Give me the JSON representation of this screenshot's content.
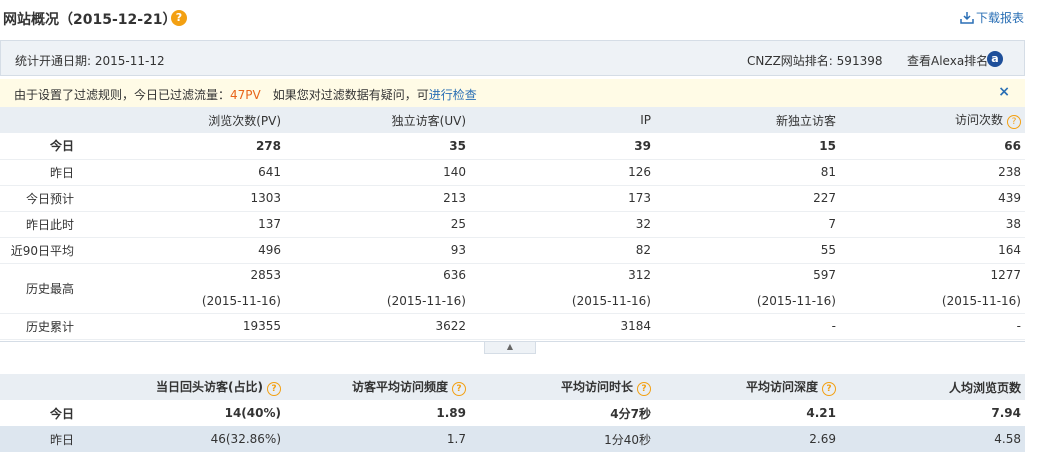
{
  "header": {
    "title": "网站概况（2015-12-21）",
    "help_icon": "?",
    "download_label": "下载报表"
  },
  "info_bar": {
    "open_date_label": "统计开通日期:",
    "open_date": "2015-11-12",
    "rank_label": "CNZZ网站排名:",
    "rank_value": "591398",
    "alexa_label": "查看Alexa排名",
    "alexa_icon": "a"
  },
  "notice": {
    "prefix": "由于设置了过滤规则，今日已过滤流量：",
    "filtered": "47PV",
    "middle": "　如果您对过滤数据有疑问，可",
    "link": "进行检查",
    "close": "×"
  },
  "table1": {
    "headers": [
      "",
      "浏览次数(PV)",
      "独立访客(UV)",
      "IP",
      "新独立访客",
      "访问次数"
    ],
    "rows": [
      {
        "label": "今日",
        "values": [
          "278",
          "35",
          "39",
          "15",
          "66"
        ]
      },
      {
        "label": "昨日",
        "values": [
          "641",
          "140",
          "126",
          "81",
          "238"
        ]
      },
      {
        "label": "今日预计",
        "values": [
          "1303",
          "213",
          "173",
          "227",
          "439"
        ]
      },
      {
        "label": "昨日此时",
        "values": [
          "137",
          "25",
          "32",
          "7",
          "38"
        ]
      },
      {
        "label": "近90日平均",
        "values": [
          "496",
          "93",
          "82",
          "55",
          "164"
        ]
      }
    ],
    "history_max": {
      "label": "历史最高",
      "values": [
        "2853",
        "636",
        "312",
        "597",
        "1277"
      ],
      "dates": [
        "(2015-11-16)",
        "(2015-11-16)",
        "(2015-11-16)",
        "(2015-11-16)",
        "(2015-11-16)"
      ]
    },
    "history_total": {
      "label": "历史累计",
      "values": [
        "19355",
        "3622",
        "3184",
        "-",
        "-"
      ]
    }
  },
  "collapse_icon": "▲",
  "table2": {
    "headers": [
      "",
      "当日回头访客(占比)",
      "访客平均访问频度",
      "平均访问时长",
      "平均访问深度",
      "人均浏览页数"
    ],
    "rows": [
      {
        "label": "今日",
        "values": [
          "14(40%)",
          "1.89",
          "4分7秒",
          "4.21",
          "7.94"
        ]
      },
      {
        "label": "昨日",
        "values": [
          "46(32.86%)",
          "1.7",
          "1分40秒",
          "2.69",
          "4.58"
        ]
      }
    ]
  },
  "colors": {
    "accent": "#2a6fb5",
    "highlight": "#e8651a",
    "help": "#f3a012",
    "header_bg": "#e9eef3"
  }
}
